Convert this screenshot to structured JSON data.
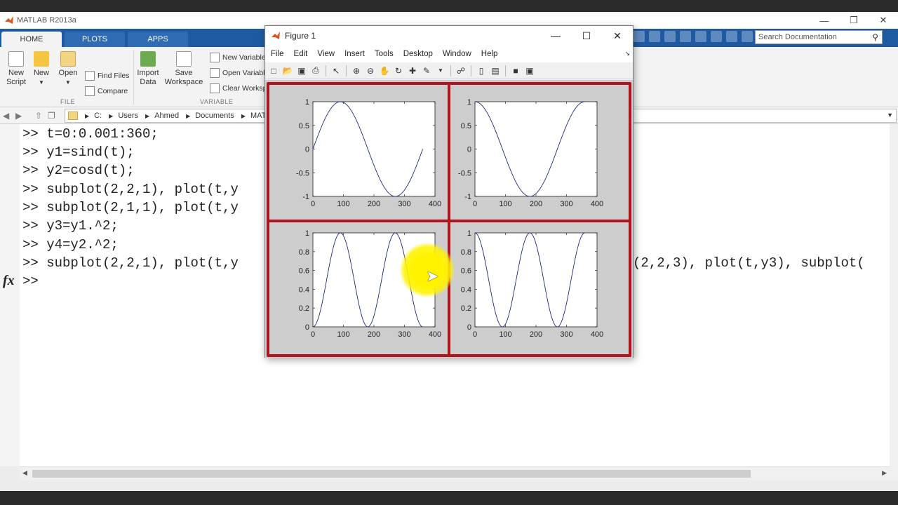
{
  "app": {
    "title": "MATLAB R2013a",
    "tabs": [
      {
        "label": "HOME",
        "active": true
      },
      {
        "label": "PLOTS",
        "active": false
      },
      {
        "label": "APPS",
        "active": false
      }
    ],
    "search_placeholder": "Search Documentation"
  },
  "ribbon": {
    "file_section": "FILE",
    "variable_section": "VARIABLE",
    "new_script": "New\nScript",
    "new": "New",
    "open": "Open",
    "find_files": "Find Files",
    "compare": "Compare",
    "import_data": "Import\nData",
    "save_workspace": "Save\nWorkspace",
    "new_variable": "New Variable",
    "open_variable": "Open Variable",
    "clear_workspace": "Clear Workspace"
  },
  "address": {
    "crumbs": [
      "C:",
      "Users",
      "Ahmed",
      "Documents",
      "MATLAB"
    ]
  },
  "command_window": {
    "lines": [
      ">> t=0:0.001:360;",
      ">> y1=sind(t);",
      ">> y2=cosd(t);",
      ">> subplot(2,2,1), plot(t,y",
      ">> subplot(2,1,1), plot(t,y",
      ">> y3=y1.^2;",
      ">> y4=y2.^2;",
      ">> subplot(2,2,1), plot(t,y",
      ">>"
    ],
    "overflow_text": "(2,2,3), plot(t,y3), subplot(",
    "fx_label": "fx"
  },
  "figure": {
    "title": "Figure 1",
    "menu": [
      "File",
      "Edit",
      "View",
      "Insert",
      "Tools",
      "Desktop",
      "Window",
      "Help"
    ]
  },
  "chart_data": [
    {
      "type": "line",
      "title": "",
      "xlabel": "",
      "ylabel": "",
      "xlim": [
        0,
        400
      ],
      "ylim": [
        -1,
        1
      ],
      "xticks": [
        0,
        100,
        200,
        300,
        400
      ],
      "yticks": [
        -1,
        -0.5,
        0,
        0.5,
        1
      ],
      "function": "sin",
      "x_range": [
        0,
        360
      ],
      "series": [
        {
          "x": [
            0,
            30,
            60,
            90,
            120,
            150,
            180,
            210,
            240,
            270,
            300,
            330,
            360
          ],
          "y": [
            0,
            0.5,
            0.866,
            1,
            0.866,
            0.5,
            0,
            -0.5,
            -0.866,
            -1,
            -0.866,
            -0.5,
            0
          ]
        }
      ]
    },
    {
      "type": "line",
      "title": "",
      "xlabel": "",
      "ylabel": "",
      "xlim": [
        0,
        400
      ],
      "ylim": [
        -1,
        1
      ],
      "xticks": [
        0,
        100,
        200,
        300,
        400
      ],
      "yticks": [
        -1,
        -0.5,
        0,
        0.5,
        1
      ],
      "function": "cos",
      "x_range": [
        0,
        360
      ],
      "series": [
        {
          "x": [
            0,
            30,
            60,
            90,
            120,
            150,
            180,
            210,
            240,
            270,
            300,
            330,
            360
          ],
          "y": [
            1,
            0.866,
            0.5,
            0,
            -0.5,
            -0.866,
            -1,
            -0.866,
            -0.5,
            0,
            0.5,
            0.866,
            1
          ]
        }
      ]
    },
    {
      "type": "line",
      "title": "",
      "xlabel": "",
      "ylabel": "",
      "xlim": [
        0,
        400
      ],
      "ylim": [
        0,
        1
      ],
      "xticks": [
        0,
        100,
        200,
        300,
        400
      ],
      "yticks": [
        0,
        0.2,
        0.4,
        0.6,
        0.8,
        1
      ],
      "function": "sin2",
      "x_range": [
        0,
        360
      ],
      "series": [
        {
          "x": [
            0,
            45,
            90,
            135,
            180,
            225,
            270,
            315,
            360
          ],
          "y": [
            0,
            0.5,
            1,
            0.5,
            0,
            0.5,
            1,
            0.5,
            0
          ]
        }
      ]
    },
    {
      "type": "line",
      "title": "",
      "xlabel": "",
      "ylabel": "",
      "xlim": [
        0,
        400
      ],
      "ylim": [
        0,
        1
      ],
      "xticks": [
        0,
        100,
        200,
        300,
        400
      ],
      "yticks": [
        0,
        0.2,
        0.4,
        0.6,
        0.8,
        1
      ],
      "function": "cos2",
      "x_range": [
        0,
        360
      ],
      "series": [
        {
          "x": [
            0,
            45,
            90,
            135,
            180,
            225,
            270,
            315,
            360
          ],
          "y": [
            1,
            0.5,
            0,
            0.5,
            1,
            0.5,
            0,
            0.5,
            1
          ]
        }
      ]
    }
  ]
}
